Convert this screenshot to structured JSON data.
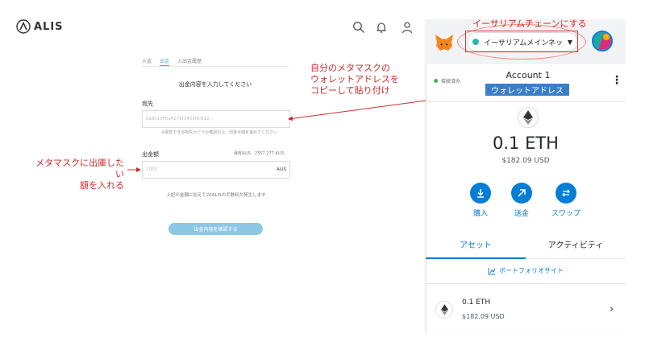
{
  "alis": {
    "logo_text": "ALIS",
    "tabs": [
      "入金",
      "出金",
      "入出金履歴"
    ],
    "form_title": "出金内容を入力してください",
    "address_label": "宛先",
    "address_placeholder": "0x8010FEa4278f34690C812...",
    "address_note": "※振替できる宛先かどうか確認の上、出金手順を進めてください",
    "amount_label": "出金額",
    "balance_text": "保有ALIS：2357.277 ALIS",
    "amount_placeholder": "1000",
    "amount_unit": "ALIS",
    "fee_note": "上記の金額に加えて20ALISの手数料が発生します",
    "confirm_button": "出金内容を確認する"
  },
  "annotations": {
    "copy_address": "自分のメタマスクの\nウォレットアドレスを\nコピーして貼り付け",
    "enter_amount": "メタマスクに出庫したい\n額を入れる",
    "network_hint": "イーサリアムチェーンにする"
  },
  "metamask": {
    "network": "イーサリアムメインネッ...",
    "connected": "接続済み",
    "account_name": "Account 1",
    "address_label": "ウォレットアドレス",
    "balance_eth": "0.1 ETH",
    "balance_usd": "$182.09 USD",
    "actions": [
      "購入",
      "送金",
      "スワップ"
    ],
    "tabs": [
      "アセット",
      "アクティビティ"
    ],
    "portfolio_link": "ポートフォリオサイト",
    "asset": {
      "name": "0.1 ETH",
      "usd": "$182.09 USD"
    }
  },
  "colors": {
    "metamask_blue": "#037dd6",
    "annotation_red": "#cc2a2a",
    "alis_button": "#8dc7e6",
    "network_dot": "#29b6af"
  }
}
